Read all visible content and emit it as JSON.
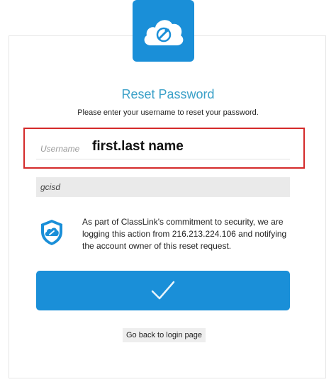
{
  "page": {
    "title": "Reset Password",
    "subtitle": "Please enter your username to reset your password."
  },
  "form": {
    "username_placeholder": "Username",
    "username_value": "first.last name",
    "tenant_value": "gcisd",
    "submit_icon": "checkmark-icon"
  },
  "notice": {
    "text": "As part of ClassLink's commitment to security, we are logging this action from 216.213.224.106 and notifying the account owner of this reset request.",
    "icon": "classlink-shield-icon"
  },
  "links": {
    "back_label": "Go back to login page"
  },
  "colors": {
    "brand_blue": "#1a8fd8",
    "title_teal": "#3aa0c8",
    "highlight_red": "#d42a2a",
    "field_gray": "#eaeaea"
  }
}
